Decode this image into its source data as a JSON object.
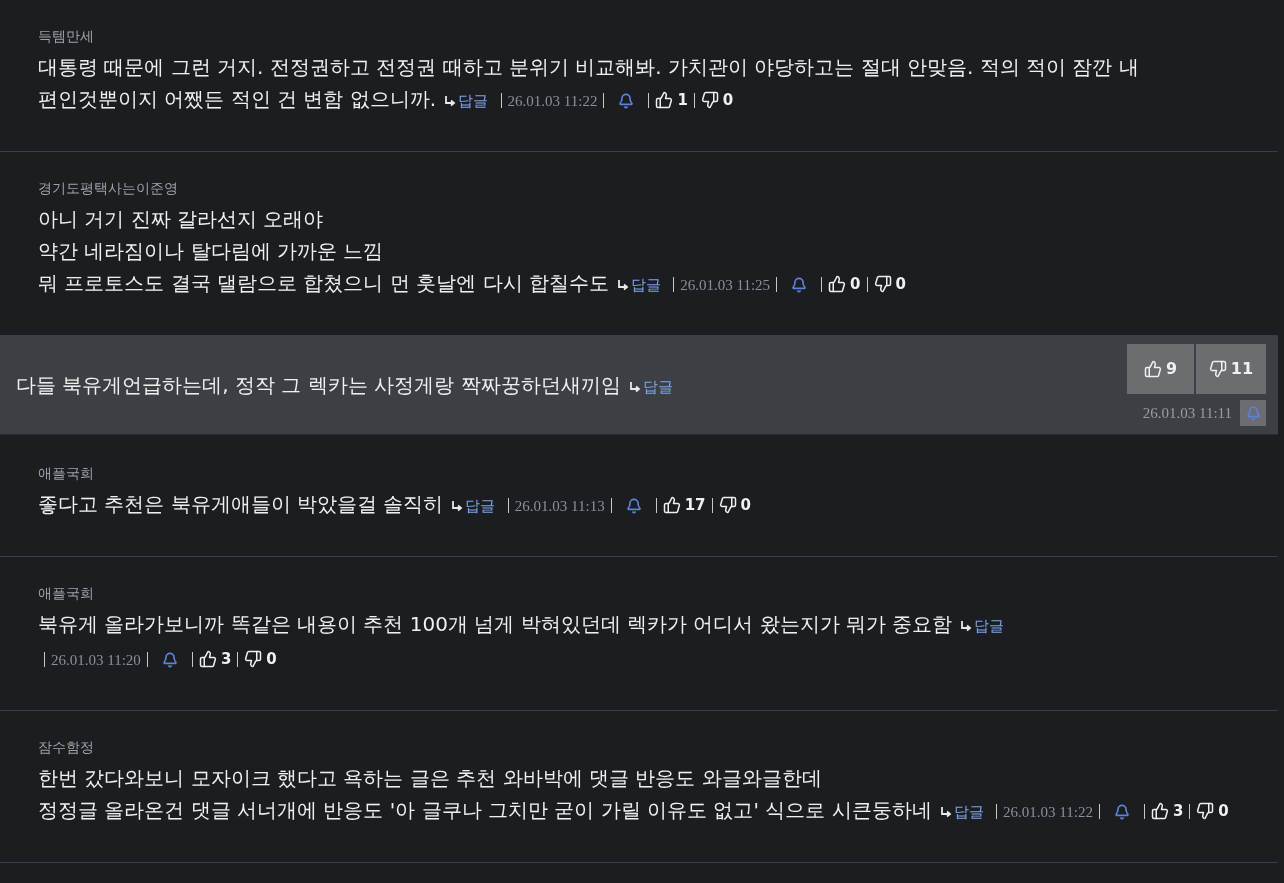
{
  "comments": [
    {
      "kind": "normal",
      "author": "득템만세",
      "lines": [
        "대통령 때문에 그런 거지. 전정권하고 전정권 때하고 분위기 비교해봐.  가치관이 야당하고는 절대 안맞음. 적의 적이 잠깐 내",
        "편인것뿐이지 어쨌든 적인 건 변함 없으니까."
      ],
      "reply": "답글",
      "date": "26.01.03 11:22",
      "likes": "1",
      "dislikes": "0"
    },
    {
      "kind": "normal",
      "author": "경기도평택사는이준영",
      "lines": [
        "아니 거기 진짜 갈라선지 오래야",
        "약간 네라짐이나 탈다림에 가까운 느낌",
        "뭐 프로토스도 결국 댈람으로 합쳤으니 먼 훗날엔 다시 합칠수도"
      ],
      "reply": "답글",
      "date": "26.01.03 11:25",
      "likes": "0",
      "dislikes": "0"
    },
    {
      "kind": "best",
      "lines": [
        "다들 북유게언급하는데, 정작 그 렉카는 사정게랑 짝짜꿍하던새끼임"
      ],
      "reply": "답글",
      "date": "26.01.03 11:11",
      "likes": "9",
      "dislikes": "11"
    },
    {
      "kind": "normal",
      "author": "애플국희",
      "lines": [
        "좋다고 추천은 북유게애들이 박았을걸 솔직히"
      ],
      "reply": "답글",
      "date": "26.01.03 11:13",
      "likes": "17",
      "dislikes": "0"
    },
    {
      "kind": "normal",
      "author": "애플국희",
      "lines": [
        "북유게 올라가보니까 똑같은 내용이 추천 100개 넘게 박혀있던데 렉카가 어디서 왔는지가 뭐가 중요함"
      ],
      "reply": "답글",
      "date": "26.01.03 11:20",
      "likes": "3",
      "dislikes": "0"
    },
    {
      "kind": "normal",
      "author": "잠수함정",
      "lines": [
        "한번 갔다와보니 모자이크 했다고 욕하는 글은 추천 와바박에 댓글 반응도 와글와글한데",
        "정정글 올라온건 댓글 서너개에 반응도 '아 글쿠나 그치만 굳이 가릴 이유도 없고' 식으로 시큰둥하네"
      ],
      "reply": "답글",
      "date": "26.01.03 11:22",
      "likes": "3",
      "dislikes": "0"
    }
  ]
}
